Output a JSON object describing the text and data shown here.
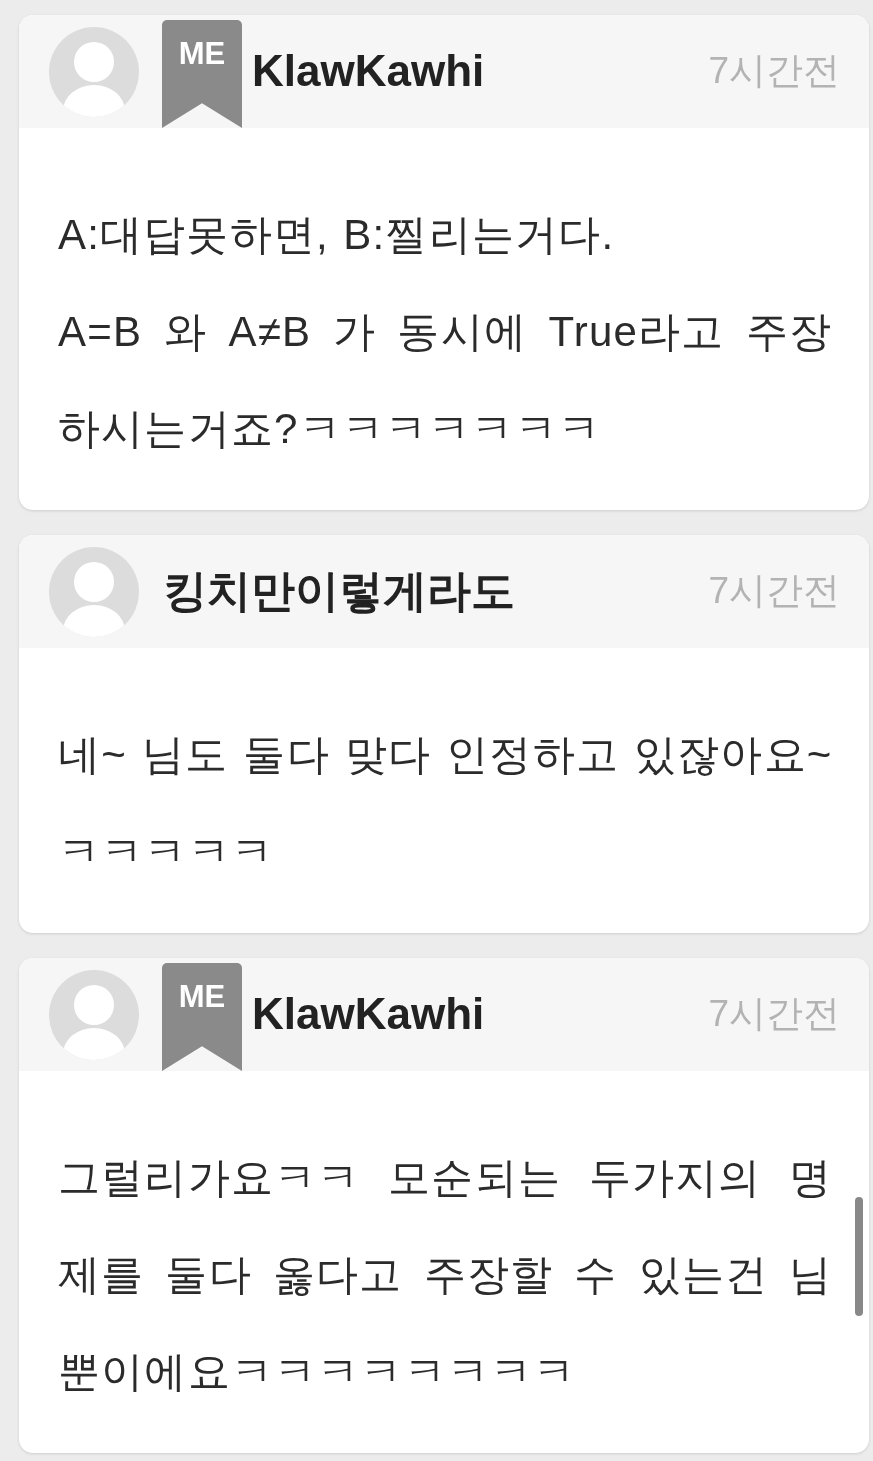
{
  "comments": [
    {
      "author": "KlawKawhi",
      "badge": "ME",
      "time": "7시간전",
      "text": "A:대답못하면, B:찔리는거다.\nA=B 와 A≠B 가 동시에 True라고 주장하시는거죠?ㅋㅋㅋㅋㅋㅋㅋ"
    },
    {
      "author": "킹치만이렇게라도",
      "time": "7시간전",
      "text": "네~ 님도 둘다 맞다 인정하고 있잖아요~ ㅋㅋㅋㅋㅋ"
    },
    {
      "author": "KlawKawhi",
      "badge": "ME",
      "time": "7시간전",
      "text": "그럴리가요ㅋㅋ 모순되는 두가지의 명제를 둘다 옳다고 주장할 수 있는건 님뿐이에요ㅋㅋㅋㅋㅋㅋㅋㅋ"
    }
  ]
}
